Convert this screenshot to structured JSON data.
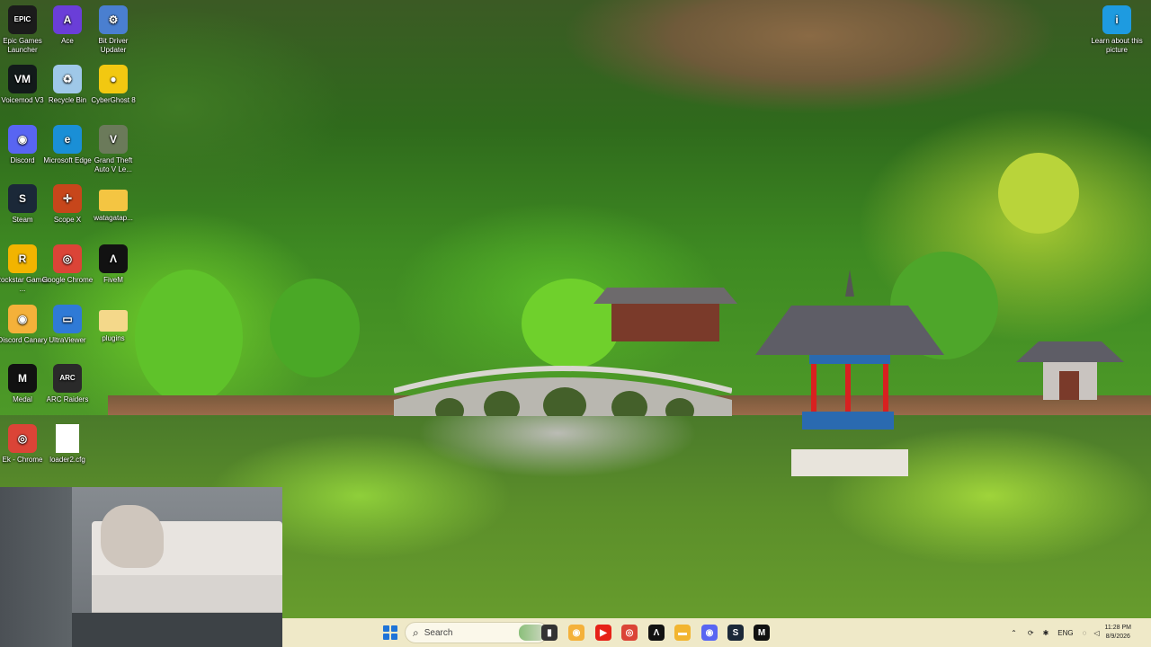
{
  "desktop_icons": [
    {
      "label": "Epic Games Launcher",
      "icon": "epic-games-icon",
      "glyph": "EPIC",
      "color": "#1b1b1b"
    },
    {
      "label": "Ace",
      "icon": "ace-icon",
      "glyph": "A",
      "color": "#6a3ed8"
    },
    {
      "label": "Bit Driver Updater",
      "icon": "gear-icon",
      "glyph": "⚙",
      "color": "#4a7fd0"
    },
    {
      "label": "Voicemod V3",
      "icon": "voicemod-icon",
      "glyph": "VM",
      "color": "#121a1a"
    },
    {
      "label": "Recycle Bin",
      "icon": "recycle-bin-icon",
      "glyph": "♻",
      "color": "#9fc8e8"
    },
    {
      "label": "CyberGhost 8",
      "icon": "cyberghost-icon",
      "glyph": "●",
      "color": "#f2c811"
    },
    {
      "label": "Discord",
      "icon": "discord-icon",
      "glyph": "◉",
      "color": "#5865f2"
    },
    {
      "label": "Microsoft Edge",
      "icon": "edge-icon",
      "glyph": "e",
      "color": "#1a8fd6"
    },
    {
      "label": "Grand Theft Auto V Le...",
      "icon": "gta-icon",
      "glyph": "V",
      "color": "#6b7a5a"
    },
    {
      "label": "Steam",
      "icon": "steam-icon",
      "glyph": "S",
      "color": "#1b2838"
    },
    {
      "label": "Scope X",
      "icon": "crosshair-icon",
      "glyph": "✛",
      "color": "#c7461b"
    },
    {
      "label": "watagatap...",
      "icon": "folder-icon",
      "glyph": "",
      "color": "#f4c542"
    },
    {
      "label": "Rockstar Games ...",
      "icon": "rockstar-icon",
      "glyph": "R",
      "color": "#f2b400"
    },
    {
      "label": "Google Chrome",
      "icon": "chrome-icon",
      "glyph": "◎",
      "color": "#db4437"
    },
    {
      "label": "FiveM",
      "icon": "fivem-icon",
      "glyph": "Λ",
      "color": "#121212"
    },
    {
      "label": "Discord Canary",
      "icon": "discord-canary-icon",
      "glyph": "◉",
      "color": "#f4b13a"
    },
    {
      "label": "UltraViewer",
      "icon": "ultraviewer-icon",
      "glyph": "▭",
      "color": "#2f7ad6"
    },
    {
      "label": "plugins",
      "icon": "folder-icon",
      "glyph": "",
      "color": "#f4d88a"
    },
    {
      "label": "Medal",
      "icon": "medal-icon",
      "glyph": "M",
      "color": "#111111"
    },
    {
      "label": "ARC Raiders",
      "icon": "arc-raiders-icon",
      "glyph": "ARC",
      "color": "#2a2a2a"
    },
    {
      "label": "Ek - Chrome",
      "icon": "chrome-icon",
      "glyph": "◎",
      "color": "#db4437"
    },
    {
      "label": "loader2.cfg",
      "icon": "file-icon",
      "glyph": "",
      "color": "#ffffff"
    }
  ],
  "learn_picture": {
    "label": "Learn about this picture",
    "icon": "learn-picture-icon",
    "color": "#1e9be0"
  },
  "taskbar": {
    "search_placeholder": "Search",
    "apps": [
      {
        "name": "task-view",
        "glyph": "▮",
        "color": "#333333"
      },
      {
        "name": "discord-canary",
        "glyph": "◉",
        "color": "#f4b13a"
      },
      {
        "name": "youtube",
        "glyph": "▶",
        "color": "#e62117"
      },
      {
        "name": "chrome",
        "glyph": "◎",
        "color": "#db4437"
      },
      {
        "name": "fivem",
        "glyph": "Λ",
        "color": "#121212"
      },
      {
        "name": "file-explorer",
        "glyph": "▬",
        "color": "#f2b530"
      },
      {
        "name": "discord",
        "glyph": "◉",
        "color": "#5865f2"
      },
      {
        "name": "steam",
        "glyph": "S",
        "color": "#1b2838"
      },
      {
        "name": "medal",
        "glyph": "M",
        "color": "#111111"
      }
    ],
    "tray": {
      "language": "ENG",
      "time": "11:28 PM",
      "date": "8/9/2026"
    }
  }
}
